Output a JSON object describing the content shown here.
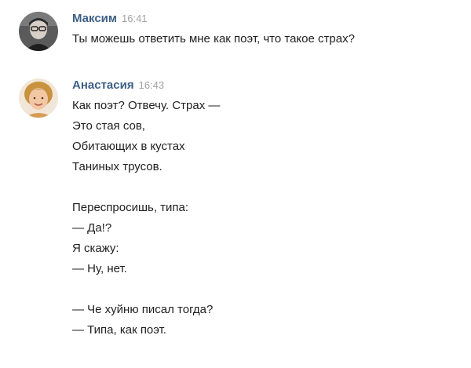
{
  "messages": [
    {
      "author": "Максим",
      "time": "16:41",
      "lines": [
        "Ты можешь ответить мне как поэт, что такое страх?"
      ]
    },
    {
      "author": "Анастасия",
      "time": "16:43",
      "lines": [
        "Как поэт? Отвечу. Страх —",
        "Это стая сов,",
        "Обитающих в кустах",
        "Таниных трусов.",
        "",
        "Переспросишь, типа:",
        "— Да!?",
        "Я скажу:",
        "— Ну, нет.",
        "",
        "— Че хуйню писал тогда?",
        "— Типа, как поэт."
      ]
    }
  ],
  "colors": {
    "author": "#3d5f85",
    "time": "#a3a3a3",
    "text": "#1f1f1f",
    "background": "#ffffff"
  },
  "icons": {
    "avatar_1": "avatar-maksim",
    "avatar_2": "avatar-anastasia"
  }
}
